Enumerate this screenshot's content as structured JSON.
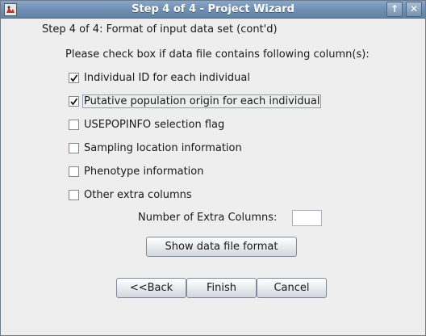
{
  "window": {
    "title": "Step 4 of 4 - Project Wizard",
    "maximize_glyph": "↑",
    "close_glyph": "✕"
  },
  "header": {
    "step_heading": "Step 4 of 4: Format of input data set (cont'd)",
    "instruction": "Please check box if data file contains following column(s):"
  },
  "options": [
    {
      "label": "Individual ID for each individual",
      "checked": true
    },
    {
      "label": "Putative population origin for each individual",
      "checked": true
    },
    {
      "label": "USEPOPINFO selection flag",
      "checked": false
    },
    {
      "label": "Sampling location information",
      "checked": false
    },
    {
      "label": "Phenotype information",
      "checked": false
    },
    {
      "label": "Other extra columns",
      "checked": false
    }
  ],
  "extra_columns": {
    "label": "Number of Extra Columns:",
    "value": ""
  },
  "buttons": {
    "show_format": "Show data file format",
    "back": "<<Back",
    "finish": "Finish",
    "cancel": "Cancel"
  },
  "colors": {
    "titlebar": "#6f8fb5",
    "background": "#eeeeee"
  }
}
